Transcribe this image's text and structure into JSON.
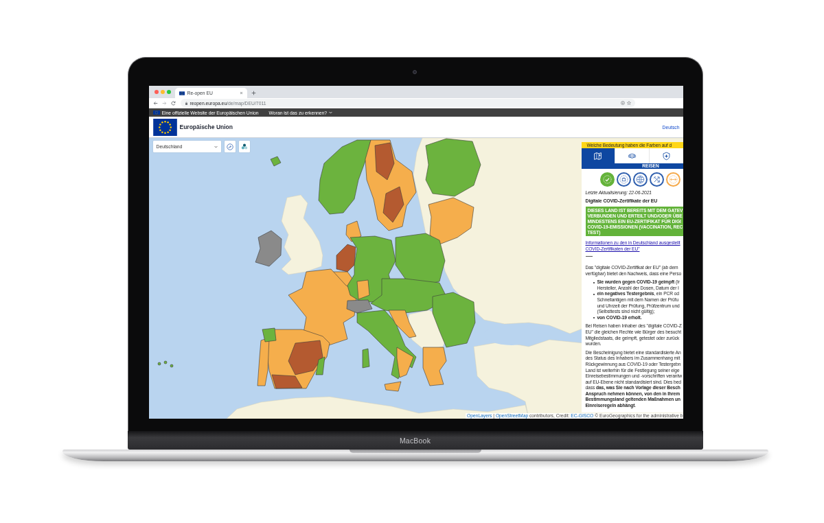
{
  "laptop": {
    "brand": "MacBook"
  },
  "browser": {
    "tabs": [
      {
        "title": "Re-open EU",
        "selected": true
      }
    ],
    "address": {
      "host": "reopen.europa.eu",
      "path": "/de/map/DEU/7011"
    }
  },
  "eu_banner": {
    "text": "Eine offizielle Website der Europäischen Union",
    "link": "Woran ist das zu erkennen?"
  },
  "header": {
    "title": "Europäische Union",
    "language": "Deutsch"
  },
  "map": {
    "country_select": {
      "value": "Deutschland"
    },
    "attribution": [
      {
        "kind": "link",
        "text": "OpenLayers"
      },
      {
        "kind": "text",
        "text": " | "
      },
      {
        "kind": "link",
        "text": "OpenStreetMap"
      },
      {
        "kind": "text",
        "text": " contributors, Credit: "
      },
      {
        "kind": "link",
        "text": "EC-GISCO"
      },
      {
        "kind": "text",
        "text": " © EuroGeographics for the administrative b"
      }
    ]
  },
  "panel": {
    "legend_bar": "Welche Bedeutung haben die Farben auf d",
    "tabs": [
      {
        "kind": "travel",
        "selected": true
      },
      {
        "kind": "mask",
        "selected": false
      },
      {
        "kind": "shield",
        "selected": false
      }
    ],
    "section": "REISEN",
    "categories": [
      {
        "kind": "certificate",
        "selected": true,
        "color": "#65b33b"
      },
      {
        "kind": "quarantine",
        "selected": false,
        "color": "#2f5fae"
      },
      {
        "kind": "test",
        "selected": false,
        "color": "#2f5fae"
      },
      {
        "kind": "travel_ban",
        "selected": false,
        "color": "#2f5fae"
      },
      {
        "kind": "entry",
        "selected": false,
        "color": "#f5a94a"
      }
    ],
    "updated": "Letzte Aktualisierung: 22-06-2021",
    "title": "Digitale COVID-Zertifikate der EU",
    "notice": [
      "DIESES LAND IST BEREITS MIT DEM GATEV",
      "VERBUNDEN UND ERTEILT UND/ODER ÜBE",
      "MINDESTENS EIN EU-ZERTIFIKAT FÜR DIGI",
      "COVID-19-EMISSIONEN (VACCINATION, REC",
      "TEST)"
    ],
    "link": [
      "Informationen zu den in Deutschland ausgestellt",
      "COVID-Zertifikaten der EU\""
    ],
    "body": [
      {
        "kind": "paragraph",
        "lines": [
          "Das \"digitale COVID-Zertifikat der EU\" (ab dem",
          "verfügbar) bietet den Nachweis, dass eine Perso"
        ]
      },
      {
        "kind": "list",
        "items": [
          {
            "bold": false,
            "lines": [
              "**Sie wurden gegen COVID-19 geimpft** (Ir",
              "Hersteller, Anzahl der Dosen, Datum der I"
            ]
          },
          {
            "bold": false,
            "lines": [
              "**ein negatives Testergebnis**, ein PCR od",
              "Schnellantigen mit dem Namen der Prüfu",
              "und Uhrzeit der Prüfung, Prüfzentrum und",
              "(Selbsttests sind nicht gültig);"
            ]
          },
          {
            "bold": true,
            "lines": [
              "von COVID-19 erholt."
            ]
          }
        ]
      },
      {
        "kind": "paragraph",
        "lines": [
          "Bei Reisen haben Inhaber des \"digitale COVID-Z",
          "EU\" die gleichen Rechte wie Bürger des besucht",
          "Mitgliedstaats, die geimpft, getestet oder zurück",
          "wurden."
        ]
      },
      {
        "kind": "paragraph",
        "lines": [
          "Die Bescheinigung bietet eine standardisierte An",
          "des Status des Inhabers im Zusammenhang mit",
          "Rückgewinnung aus COVID-19 oder Testergebn",
          "Land ist weiterhin für die Festlegung seiner eige",
          "Einreisebestimmungen und -vorschriften verantw",
          "auf EU-Ebene nicht standardisiert sind. Dies bed",
          "dass **das, was Sie nach Vorlage dieser Besch**",
          "**Anspruch nehmen können, von den in Ihrem**",
          "**Bestimmungsland geltenden Maßnahmen un**",
          "**Einreiseregeln abhängt**."
        ]
      }
    ]
  }
}
